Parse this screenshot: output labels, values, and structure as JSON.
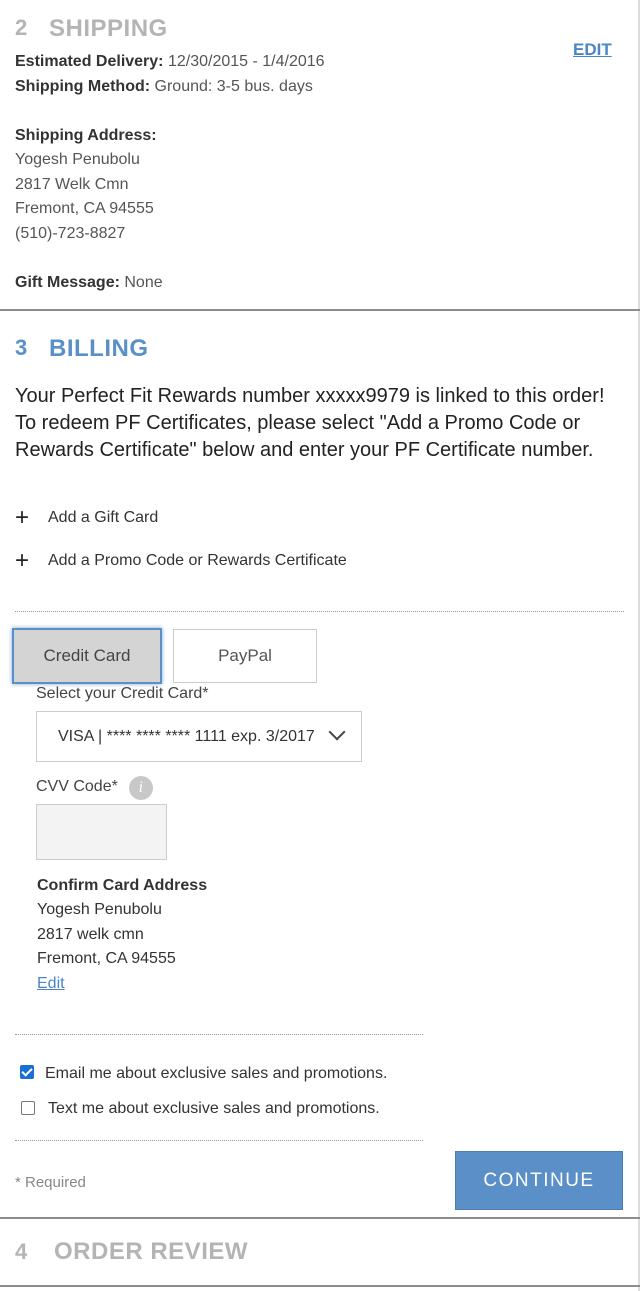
{
  "shipping": {
    "number": "2",
    "title": "SHIPPING",
    "edit_label": "EDIT",
    "estimated_delivery_label": "Estimated Delivery:",
    "estimated_delivery_value": " 12/30/2015 - 1/4/2016",
    "shipping_method_label": "Shipping Method:",
    "shipping_method_value": " Ground: 3-5 bus. days",
    "address_label": "Shipping Address:",
    "address_lines": [
      "Yogesh Penubolu",
      "2817 Welk Cmn",
      "Fremont, CA 94555",
      "(510)-723-8827"
    ],
    "gift_message_label": "Gift Message:",
    "gift_message_value": " None"
  },
  "billing": {
    "number": "3",
    "title": "BILLING",
    "rewards_message": "Your Perfect Fit Rewards number xxxxx9979 is linked to this order! To redeem PF Certificates, please select \"Add a Promo Code or Rewards Certificate\" below and enter your PF Certificate number.",
    "add_gift_card": "Add a Gift Card",
    "add_promo": "Add a Promo Code or Rewards Certificate",
    "tabs": {
      "credit_card": "Credit Card",
      "paypal": "PayPal"
    },
    "select_card_label": "Select your Credit Card*",
    "selected_card": "VISA | **** **** **** 1111 exp. 3/2017",
    "cvv_label": "CVV Code*",
    "info_glyph": "i",
    "confirm_address_label": "Confirm Card Address",
    "card_address_lines": [
      "Yogesh Penubolu",
      "2817 welk cmn",
      "Fremont, CA 94555"
    ],
    "edit_link": "Edit",
    "email_optin": {
      "label": "Email me about exclusive sales and promotions.",
      "checked": true
    },
    "text_optin": {
      "label": "Text me about exclusive sales and promotions.",
      "checked": false
    },
    "required_note": "* Required",
    "continue_label": "CONTINUE"
  },
  "order_review": {
    "number": "4",
    "title": "ORDER REVIEW"
  },
  "colors": {
    "accent": "#5b8fc7",
    "link": "#4a86c5",
    "muted_heading": "#b4b4b4"
  },
  "icons": {
    "add": "plus-icon",
    "dropdown": "chevron-down-icon",
    "info": "info-icon",
    "check": "checkbox-icon"
  }
}
